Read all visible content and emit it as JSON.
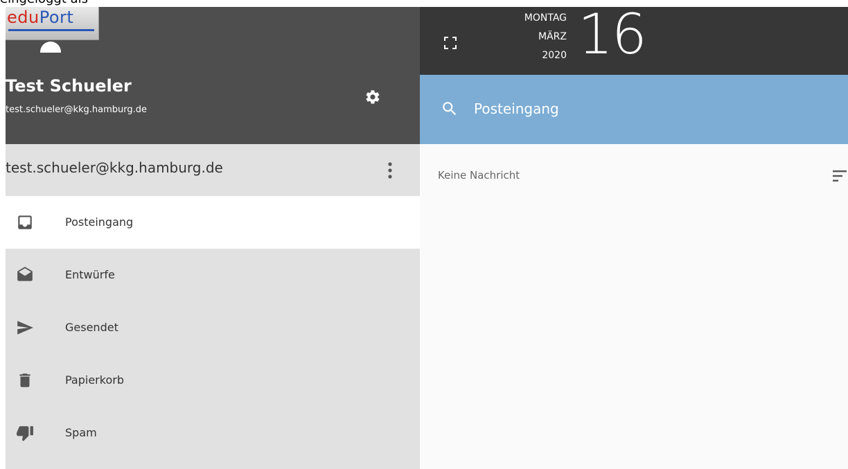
{
  "top_strip": {
    "text": "eingeloggt als"
  },
  "logo": {
    "edu": "edu",
    "port": "Port"
  },
  "profile": {
    "name": "Test Schueler",
    "email": "test.schueler@kkg.hamburg.de"
  },
  "account": {
    "label": "test.schueler@kkg.hamburg.de"
  },
  "folders": [
    {
      "label": "Posteingang",
      "icon": "inbox-icon",
      "active": true
    },
    {
      "label": "Entwürfe",
      "icon": "drafts-icon",
      "active": false
    },
    {
      "label": "Gesendet",
      "icon": "send-icon",
      "active": false
    },
    {
      "label": "Papierkorb",
      "icon": "trash-icon",
      "active": false
    },
    {
      "label": "Spam",
      "icon": "thumbs-down-icon",
      "active": false
    }
  ],
  "date": {
    "weekday": "MONTAG",
    "month": "MÄRZ",
    "year": "2020",
    "day": "16"
  },
  "search": {
    "label": "Posteingang"
  },
  "messages": {
    "empty_text": "Keine Nachricht"
  },
  "colors": {
    "profile_bg": "#4e4e4e",
    "sidebar_bg": "#e1e1e1",
    "date_bar_bg": "#373737",
    "search_bar_bg": "#7dadd5",
    "message_area_bg": "#fafafa",
    "icon_color": "#555555"
  }
}
